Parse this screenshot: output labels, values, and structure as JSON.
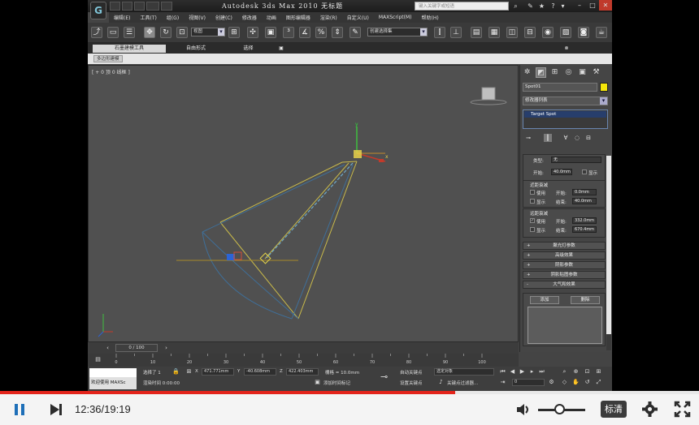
{
  "app": {
    "logo_text": "G",
    "title": "Autodesk 3ds Max  2010     无标题",
    "search_placeholder": "键入关键字或短语"
  },
  "menu": [
    "编辑(E)",
    "工具(T)",
    "组(G)",
    "视图(V)",
    "创建(C)",
    "修改器",
    "动画",
    "图形编辑器",
    "渲染(R)",
    "自定义(U)",
    "MAXScript(M)",
    "帮助(H)"
  ],
  "toolbar": {
    "view_dropdown": "视图",
    "selection_set_dropdown": "创建选择集"
  },
  "ribbon": {
    "tabs": [
      "石墨建模工具",
      "自由形式",
      "选择",
      "▣"
    ],
    "active_tab": 0,
    "sub_label": "多边形建模"
  },
  "viewport": {
    "label": "[ + 0 顶 0 线框 ]"
  },
  "command_panel": {
    "object_name": "Spot01",
    "object_color": "#f5e60a",
    "modifier_list": "修改器列表",
    "stack_item": "Target Spot",
    "shadow_section": {
      "type_label": "类型:",
      "type_value": "无",
      "start_label": "开始:",
      "start_value": "40.0mm",
      "show_label": "显示"
    },
    "near_atten": {
      "title": "近距衰减",
      "use_label": "使用",
      "start_label": "开始:",
      "start_value": "0.0mm",
      "show_label": "显示",
      "end_label": "结束:",
      "end_value": "40.0mm"
    },
    "far_atten": {
      "title": "远距衰减",
      "use_label": "使用",
      "start_label": "开始:",
      "start_value": "332.0mm",
      "show_label": "显示",
      "end_label": "结束:",
      "end_value": "670.4mm"
    },
    "rollouts": [
      {
        "sign": "+",
        "label": "聚光灯参数"
      },
      {
        "sign": "+",
        "label": "高级效果"
      },
      {
        "sign": "+",
        "label": "阴影参数"
      },
      {
        "sign": "+",
        "label": "阴影贴图参数"
      },
      {
        "sign": "-",
        "label": "大气和效果"
      }
    ],
    "atm_add": "添加",
    "atm_delete": "删除"
  },
  "timeline": {
    "slider_label": "0 / 100",
    "ticks": [
      "0",
      "10",
      "20",
      "30",
      "40",
      "50",
      "60",
      "70",
      "80",
      "90",
      "100"
    ]
  },
  "status": {
    "maxscript_label": "欢迎使用 MAXSc",
    "selected": "选择了 1",
    "render_time": "渲染时间  0:00:00",
    "x_value": "471.771mm",
    "y_value": "-40.608mm",
    "z_value": "422.403mm",
    "grid": "栅格 = 10.0mm",
    "add_time_tag": "添加时间标记",
    "auto_key": "自动关键点",
    "set_key": "设置关键点",
    "selected_object": "选定对象",
    "key_filters": "关键点过滤器...",
    "frame_value": "0"
  },
  "player": {
    "time": "12:36/19:19",
    "progress": 0.651,
    "volume": 0.45,
    "quality": "标清"
  }
}
